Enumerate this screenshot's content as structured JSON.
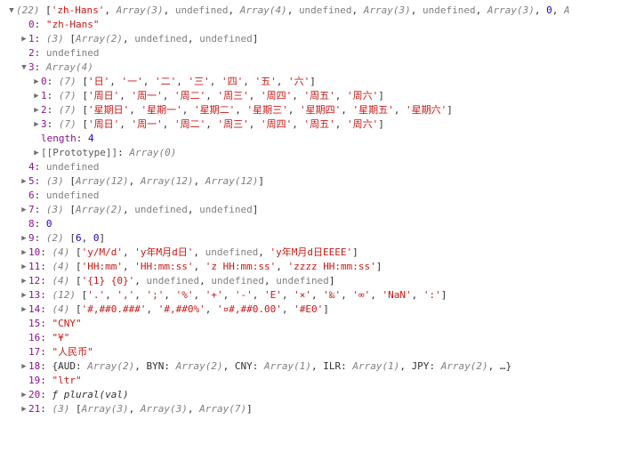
{
  "top": {
    "summary_len": "(22)",
    "items": [
      {
        "t": "str",
        "v": "'zh-Hans'"
      },
      {
        "t": "obj",
        "v": "Array(3)"
      },
      {
        "t": "undef",
        "v": "undefined"
      },
      {
        "t": "obj",
        "v": "Array(4)"
      },
      {
        "t": "undef",
        "v": "undefined"
      },
      {
        "t": "obj",
        "v": "Array(3)"
      },
      {
        "t": "undef",
        "v": "undefined"
      },
      {
        "t": "obj",
        "v": "Array(3)"
      },
      {
        "t": "num",
        "v": "0"
      },
      {
        "t": "obj",
        "v": "A"
      }
    ]
  },
  "lines": [
    {
      "indent": 1,
      "arrow": "blank",
      "key": "0",
      "kc": "key",
      "parts": [
        {
          "t": "str",
          "v": "\"zh-Hans\""
        }
      ]
    },
    {
      "indent": 1,
      "arrow": "right",
      "key": "1",
      "kc": "key",
      "pre": "(3) [",
      "post": "]",
      "items": [
        {
          "t": "obj",
          "v": "Array(2)"
        },
        {
          "t": "undef",
          "v": "undefined"
        },
        {
          "t": "undef",
          "v": "undefined"
        }
      ]
    },
    {
      "indent": 1,
      "arrow": "blank",
      "key": "2",
      "kc": "key",
      "parts": [
        {
          "t": "undef",
          "v": "undefined"
        }
      ]
    },
    {
      "indent": 1,
      "arrow": "down",
      "key": "3",
      "kc": "key",
      "parts": [
        {
          "t": "obj",
          "v": "Array(4)"
        }
      ]
    },
    {
      "indent": 2,
      "arrow": "right",
      "key": "0",
      "kc": "key",
      "pre": "(7) [",
      "post": "]",
      "items": [
        {
          "t": "str",
          "v": "'日'"
        },
        {
          "t": "str",
          "v": "'一'"
        },
        {
          "t": "str",
          "v": "'二'"
        },
        {
          "t": "str",
          "v": "'三'"
        },
        {
          "t": "str",
          "v": "'四'"
        },
        {
          "t": "str",
          "v": "'五'"
        },
        {
          "t": "str",
          "v": "'六'"
        }
      ]
    },
    {
      "indent": 2,
      "arrow": "right",
      "key": "1",
      "kc": "key",
      "pre": "(7) [",
      "post": "]",
      "items": [
        {
          "t": "str",
          "v": "'周日'"
        },
        {
          "t": "str",
          "v": "'周一'"
        },
        {
          "t": "str",
          "v": "'周二'"
        },
        {
          "t": "str",
          "v": "'周三'"
        },
        {
          "t": "str",
          "v": "'周四'"
        },
        {
          "t": "str",
          "v": "'周五'"
        },
        {
          "t": "str",
          "v": "'周六'"
        }
      ]
    },
    {
      "indent": 2,
      "arrow": "right",
      "key": "2",
      "kc": "key",
      "pre": "(7) [",
      "post": "]",
      "items": [
        {
          "t": "str",
          "v": "'星期日'"
        },
        {
          "t": "str",
          "v": "'星期一'"
        },
        {
          "t": "str",
          "v": "'星期二'"
        },
        {
          "t": "str",
          "v": "'星期三'"
        },
        {
          "t": "str",
          "v": "'星期四'"
        },
        {
          "t": "str",
          "v": "'星期五'"
        },
        {
          "t": "str",
          "v": "'星期六'"
        }
      ]
    },
    {
      "indent": 2,
      "arrow": "right",
      "key": "3",
      "kc": "key",
      "pre": "(7) [",
      "post": "]",
      "items": [
        {
          "t": "str",
          "v": "'周日'"
        },
        {
          "t": "str",
          "v": "'周一'"
        },
        {
          "t": "str",
          "v": "'周二'"
        },
        {
          "t": "str",
          "v": "'周三'"
        },
        {
          "t": "str",
          "v": "'周四'"
        },
        {
          "t": "str",
          "v": "'周五'"
        },
        {
          "t": "str",
          "v": "'周六'"
        }
      ]
    },
    {
      "indent": 2,
      "arrow": "blank",
      "key": "length",
      "kc": "key",
      "parts": [
        {
          "t": "num",
          "v": "4"
        }
      ]
    },
    {
      "indent": 2,
      "arrow": "right",
      "key": "[[Prototype]]",
      "kc": "dim",
      "parts": [
        {
          "t": "obj",
          "v": "Array(0)"
        }
      ]
    },
    {
      "indent": 1,
      "arrow": "blank",
      "key": "4",
      "kc": "key",
      "parts": [
        {
          "t": "undef",
          "v": "undefined"
        }
      ]
    },
    {
      "indent": 1,
      "arrow": "right",
      "key": "5",
      "kc": "key",
      "pre": "(3) [",
      "post": "]",
      "items": [
        {
          "t": "obj",
          "v": "Array(12)"
        },
        {
          "t": "obj",
          "v": "Array(12)"
        },
        {
          "t": "obj",
          "v": "Array(12)"
        }
      ]
    },
    {
      "indent": 1,
      "arrow": "blank",
      "key": "6",
      "kc": "key",
      "parts": [
        {
          "t": "undef",
          "v": "undefined"
        }
      ]
    },
    {
      "indent": 1,
      "arrow": "right",
      "key": "7",
      "kc": "key",
      "pre": "(3) [",
      "post": "]",
      "items": [
        {
          "t": "obj",
          "v": "Array(2)"
        },
        {
          "t": "undef",
          "v": "undefined"
        },
        {
          "t": "undef",
          "v": "undefined"
        }
      ]
    },
    {
      "indent": 1,
      "arrow": "blank",
      "key": "8",
      "kc": "key",
      "parts": [
        {
          "t": "num",
          "v": "0"
        }
      ]
    },
    {
      "indent": 1,
      "arrow": "right",
      "key": "9",
      "kc": "key",
      "pre": "(2) [",
      "post": "]",
      "items": [
        {
          "t": "num",
          "v": "6"
        },
        {
          "t": "num",
          "v": "0"
        }
      ]
    },
    {
      "indent": 1,
      "arrow": "right",
      "key": "10",
      "kc": "key",
      "pre": "(4) [",
      "post": "]",
      "items": [
        {
          "t": "str",
          "v": "'y/M/d'"
        },
        {
          "t": "str",
          "v": "'y年M月d日'"
        },
        {
          "t": "undef",
          "v": "undefined"
        },
        {
          "t": "str",
          "v": "'y年M月d日EEEE'"
        }
      ]
    },
    {
      "indent": 1,
      "arrow": "right",
      "key": "11",
      "kc": "key",
      "pre": "(4) [",
      "post": "]",
      "items": [
        {
          "t": "str",
          "v": "'HH:mm'"
        },
        {
          "t": "str",
          "v": "'HH:mm:ss'"
        },
        {
          "t": "str",
          "v": "'z HH:mm:ss'"
        },
        {
          "t": "str",
          "v": "'zzzz HH:mm:ss'"
        }
      ]
    },
    {
      "indent": 1,
      "arrow": "right",
      "key": "12",
      "kc": "key",
      "pre": "(4) [",
      "post": "]",
      "items": [
        {
          "t": "str",
          "v": "'{1} {0}'"
        },
        {
          "t": "undef",
          "v": "undefined"
        },
        {
          "t": "undef",
          "v": "undefined"
        },
        {
          "t": "undef",
          "v": "undefined"
        }
      ]
    },
    {
      "indent": 1,
      "arrow": "right",
      "key": "13",
      "kc": "key",
      "pre": "(12) [",
      "post": "]",
      "items": [
        {
          "t": "str",
          "v": "'.'"
        },
        {
          "t": "str",
          "v": "','"
        },
        {
          "t": "str",
          "v": "';'"
        },
        {
          "t": "str",
          "v": "'%'"
        },
        {
          "t": "str",
          "v": "'+'"
        },
        {
          "t": "str",
          "v": "'-'"
        },
        {
          "t": "str",
          "v": "'E'"
        },
        {
          "t": "str",
          "v": "'×'"
        },
        {
          "t": "str",
          "v": "'‰'"
        },
        {
          "t": "str",
          "v": "'∞'"
        },
        {
          "t": "str",
          "v": "'NaN'"
        },
        {
          "t": "str",
          "v": "':'"
        }
      ]
    },
    {
      "indent": 1,
      "arrow": "right",
      "key": "14",
      "kc": "key",
      "pre": "(4) [",
      "post": "]",
      "items": [
        {
          "t": "str",
          "v": "'#,##0.###'"
        },
        {
          "t": "str",
          "v": "'#,##0%'"
        },
        {
          "t": "str",
          "v": "'¤#,##0.00'"
        },
        {
          "t": "str",
          "v": "'#E0'"
        }
      ]
    },
    {
      "indent": 1,
      "arrow": "blank",
      "key": "15",
      "kc": "key",
      "parts": [
        {
          "t": "str",
          "v": "\"CNY\""
        }
      ]
    },
    {
      "indent": 1,
      "arrow": "blank",
      "key": "16",
      "kc": "key",
      "parts": [
        {
          "t": "str",
          "v": "\"¥\""
        }
      ]
    },
    {
      "indent": 1,
      "arrow": "blank",
      "key": "17",
      "kc": "key",
      "parts": [
        {
          "t": "str",
          "v": "\"人民币\""
        }
      ]
    },
    {
      "indent": 1,
      "arrow": "right",
      "key": "18",
      "kc": "key",
      "objprops": [
        {
          "k": "AUD",
          "v": "Array(2)"
        },
        {
          "k": "BYN",
          "v": "Array(2)"
        },
        {
          "k": "CNY",
          "v": "Array(1)"
        },
        {
          "k": "ILR",
          "v": "Array(1)"
        },
        {
          "k": "JPY",
          "v": "Array(2)"
        }
      ],
      "trailing": ", …}"
    },
    {
      "indent": 1,
      "arrow": "blank",
      "key": "19",
      "kc": "key",
      "parts": [
        {
          "t": "str",
          "v": "\"ltr\""
        }
      ]
    },
    {
      "indent": 1,
      "arrow": "right",
      "key": "20",
      "kc": "key",
      "parts": [
        {
          "t": "fn",
          "v": "ƒ plural(val)"
        }
      ]
    },
    {
      "indent": 1,
      "arrow": "right",
      "key": "21",
      "kc": "key",
      "pre": "(3) [",
      "post": "]",
      "items": [
        {
          "t": "obj",
          "v": "Array(3)"
        },
        {
          "t": "obj",
          "v": "Array(3)"
        },
        {
          "t": "obj",
          "v": "Array(7)"
        }
      ]
    }
  ]
}
